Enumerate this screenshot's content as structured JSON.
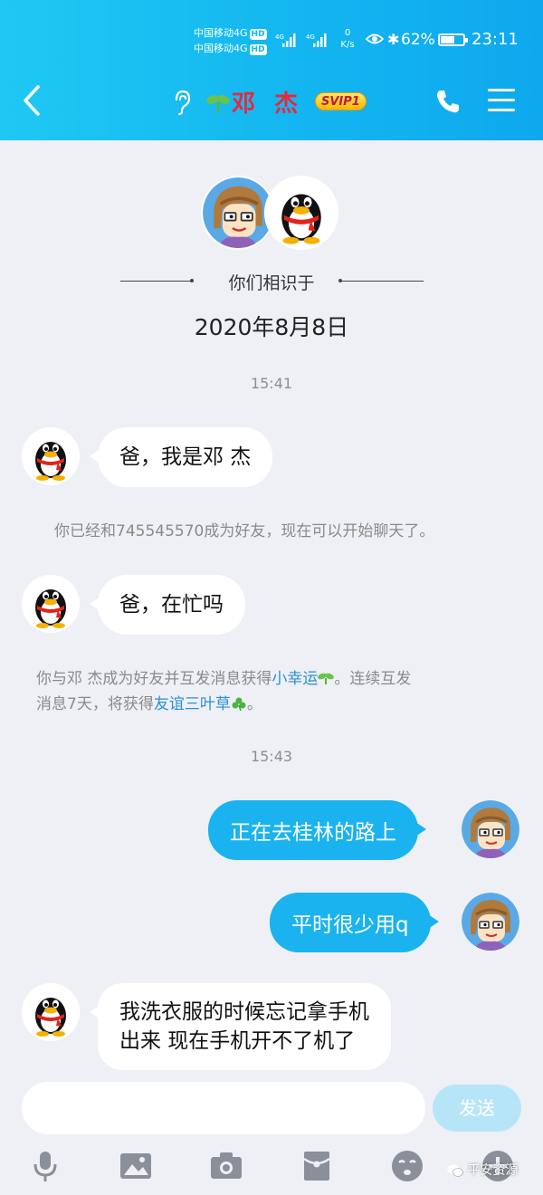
{
  "status_bar": {
    "carrier_1": "中国移动4G",
    "carrier_2": "中国移动4G",
    "hd": "HD",
    "net_speed_value": "0",
    "net_speed_unit": "K/s",
    "battery_percent": "62%",
    "battery_level": 0.62,
    "time": "23:11"
  },
  "header": {
    "contact_name": "邓 杰",
    "vip_badge": "SVIP1",
    "icons": [
      "back-icon",
      "ear-icon",
      "sprout-icon",
      "phone-icon",
      "menu-icon"
    ]
  },
  "intro": {
    "met_label": "你们相识于",
    "met_date": "2020年8月8日"
  },
  "chat": {
    "time_1": "15:41",
    "msg_1": "爸，我是邓 杰",
    "sys_1": "你已经和745545570成为好友，现在可以开始聊天了。",
    "msg_2": "爸，在忙吗",
    "sys_2_part1": "你与邓  杰成为好友并互发消息获得",
    "sys_2_link1": "小幸运",
    "sys_2_part2": "。连续互发",
    "sys_2_part3": "消息7天，将获得",
    "sys_2_link2": "友谊三叶草",
    "sys_2_part4": "。",
    "time_2": "15:43",
    "msg_3": "正在去桂林的路上",
    "msg_4": "平时很少用q",
    "msg_5_line1": "我洗衣服的时候忘记拿手机",
    "msg_5_line2": "出来 现在手机开不了机了"
  },
  "composer": {
    "send_label": "发送",
    "tools": [
      "microphone-icon",
      "image-icon",
      "camera-icon",
      "red-packet-icon",
      "emoji-icon",
      "plus-icon"
    ]
  },
  "watermark": "平安资源",
  "colors": {
    "header_gradient_start": "#1fc8f3",
    "header_gradient_end": "#0ea8ee",
    "outgoing_bubble": "#1ab3ef",
    "background": "#eef0f5",
    "link": "#2b8fd6",
    "name_red": "#e8283c"
  }
}
